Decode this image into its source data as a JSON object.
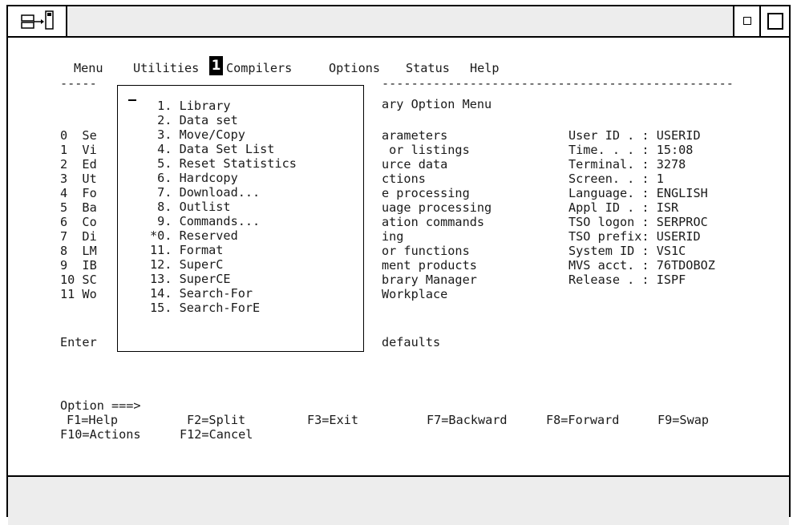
{
  "menubar": {
    "items": [
      "Menu",
      "Utilities",
      "Compilers",
      "Options",
      "Status",
      "Help"
    ],
    "callout": "1",
    "divider_left": "-----",
    "divider_right": "------------------------------------------------"
  },
  "primary_menu": {
    "title_fragment": "ary Option Menu",
    "left_items": [
      "0  Se",
      "1  Vi",
      "2  Ed",
      "3  Ut",
      "4  Fo",
      "5  Ba",
      "6  Co",
      "7  Di",
      "8  LM",
      "9  IB",
      "10 SC",
      "11 Wo"
    ],
    "right_items": [
      "arameters",
      " or listings",
      "urce data",
      "ctions",
      "e processing",
      "uage processing",
      "ation commands",
      "ing",
      "or functions",
      "ment products",
      "brary Manager",
      "Workplace"
    ],
    "enter_fragment": "Enter",
    "defaults_fragment": "defaults"
  },
  "session_info": [
    "User ID . : USERID",
    "Time. . . : 15:08",
    "Terminal. : 3278",
    "Screen. . : 1",
    "Language. : ENGLISH",
    "Appl ID . : ISR",
    "TSO logon : SERPROC",
    "TSO prefix: USERID",
    "System ID : VS1C",
    "MVS acct. : 76TDOBOZ",
    "Release . : ISPF"
  ],
  "utilities_popup": {
    "items": [
      " 1. Library",
      " 2. Data set",
      " 3. Move/Copy",
      " 4. Data Set List",
      " 5. Reset Statistics",
      " 6. Hardcopy",
      " 7. Download...",
      " 8. Outlist",
      " 9. Commands...",
      "*0. Reserved",
      "11. Format",
      "12. SuperC",
      "13. SuperCE",
      "14. Search-For",
      "15. Search-ForE"
    ]
  },
  "command": {
    "prompt": "Option ===>",
    "value": ""
  },
  "function_keys": [
    "F1=Help",
    "F2=Split",
    "F3=Exit",
    "F7=Backward",
    "F8=Forward",
    "F9=Swap",
    "F10=Actions",
    "F12=Cancel"
  ],
  "icons": {
    "system_menu": "move-arrow-icon",
    "minimize": "minimize-icon",
    "maximize": "maximize-icon"
  }
}
